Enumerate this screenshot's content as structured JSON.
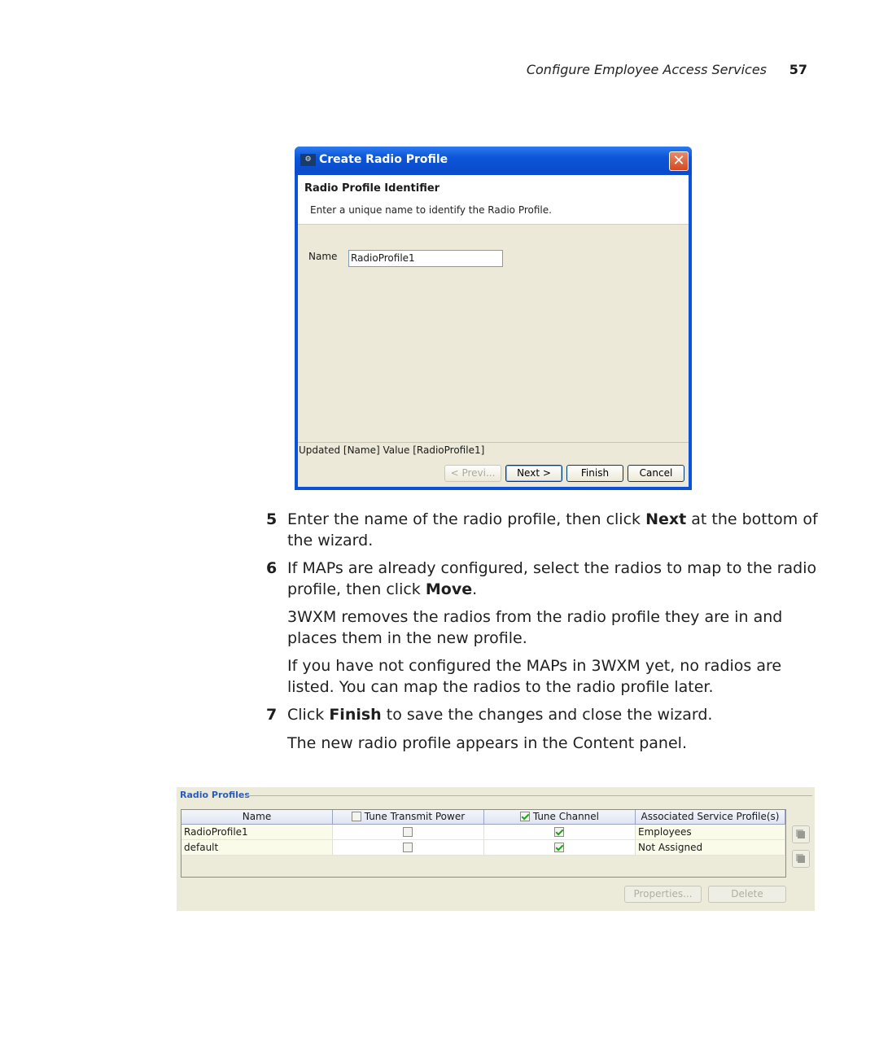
{
  "page_header": {
    "section_title": "Configure Employee Access Services",
    "page_number": "57"
  },
  "dialog": {
    "title": "Create Radio Profile",
    "app_icon": "network-icon",
    "close_icon": "close-icon",
    "header_title": "Radio Profile Identifier",
    "header_description": "Enter a unique name to identify the Radio Profile.",
    "name_label": "Name",
    "name_value": "RadioProfile1",
    "status": "Updated [Name] Value [RadioProfile1]",
    "buttons": {
      "previous": "< Previ...",
      "next": "Next >",
      "finish": "Finish",
      "cancel": "Cancel"
    }
  },
  "steps": [
    {
      "number": "5",
      "pre": "Enter the name of the radio profile, then click ",
      "bold": "Next",
      "post": " at the bottom of the wizard."
    },
    {
      "number": "6",
      "pre": "If MAPs are already configured, select the radios to map to the radio profile, then click ",
      "bold": "Move",
      "post": "."
    },
    {
      "paragraph": "3WXM removes the radios from the radio profile they are in and places them in the new profile."
    },
    {
      "paragraph": "If you have not configured the MAPs in 3WXM yet, no radios are listed. You can map the radios to the radio profile later."
    },
    {
      "number": "7",
      "pre": "Click ",
      "bold": "Finish",
      "post": " to save the changes and close the wizard."
    },
    {
      "paragraph": "The new radio profile appears in the Content panel."
    }
  ],
  "radio_profiles_panel": {
    "title": "Radio Profiles",
    "columns": [
      {
        "label": "Name",
        "checkbox": null
      },
      {
        "label": "Tune Transmit Power",
        "checkbox": false
      },
      {
        "label": "Tune Channel",
        "checkbox": true
      },
      {
        "label": "Associated Service Profile(s)",
        "checkbox": null
      }
    ],
    "rows": [
      {
        "name": "RadioProfile1",
        "tune_transmit_power": false,
        "tune_channel": true,
        "associated": "Employees"
      },
      {
        "name": "default",
        "tune_transmit_power": false,
        "tune_channel": true,
        "associated": "Not Assigned"
      }
    ],
    "side_buttons": [
      "copy-icon",
      "paste-icon"
    ],
    "buttons": {
      "properties": "Properties...",
      "delete": "Delete"
    }
  }
}
